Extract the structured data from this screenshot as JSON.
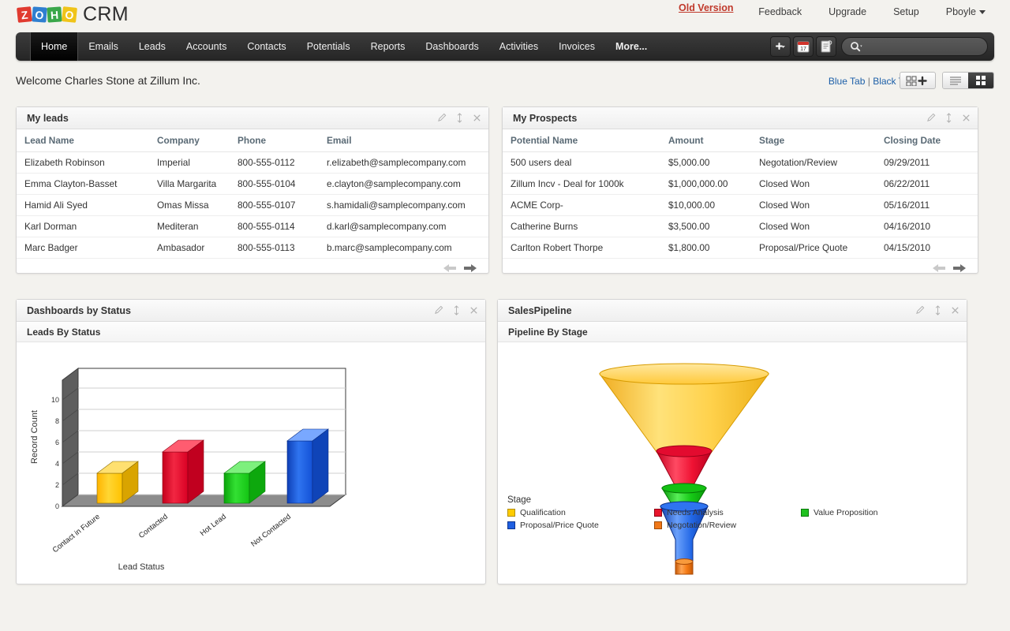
{
  "brand": {
    "tiles": [
      "Z",
      "O",
      "H",
      "O"
    ],
    "product": "CRM"
  },
  "header": {
    "old_version": "Old Version",
    "links": [
      "Feedback",
      "Upgrade",
      "Setup"
    ],
    "user": "Pboyle"
  },
  "nav": {
    "items": [
      "Home",
      "Emails",
      "Leads",
      "Accounts",
      "Contacts",
      "Potentials",
      "Reports",
      "Dashboards",
      "Activities",
      "Invoices",
      "More..."
    ],
    "active": "Home",
    "tools": [
      "add-icon",
      "calendar-icon",
      "notes-icon"
    ],
    "calendar_day": "17",
    "search_placeholder": ""
  },
  "welcome": {
    "text": "Welcome Charles Stone at Zillum Inc."
  },
  "tabs": {
    "blue": "Blue Tab",
    "separator": "|",
    "black": "Black Tab"
  },
  "view": {
    "add_label": "add-widget",
    "list_label": "list-view",
    "grid_label": "grid-view"
  },
  "panels": {
    "leads": {
      "title": "My leads",
      "columns": [
        "Lead Name",
        "Company",
        "Phone",
        "Email"
      ],
      "rows": [
        [
          "Elizabeth Robinson",
          "Imperial",
          "800-555-0112",
          "r.elizabeth@samplecompany.com"
        ],
        [
          "Emma Clayton-Basset",
          "Villa Margarita",
          "800-555-0104",
          "e.clayton@samplecompany.com"
        ],
        [
          "Hamid Ali Syed",
          "Omas Missa",
          "800-555-0107",
          "s.hamidali@samplecompany.com"
        ],
        [
          "Karl Dorman",
          "Mediteran",
          "800-555-0114",
          "d.karl@samplecompany.com"
        ],
        [
          "Marc Badger",
          "Ambasador",
          "800-555-0113",
          "b.marc@samplecompany.com"
        ]
      ]
    },
    "prospects": {
      "title": "My Prospects",
      "columns": [
        "Potential Name",
        "Amount",
        "Stage",
        "Closing Date"
      ],
      "rows": [
        [
          "500 users deal",
          "$5,000.00",
          "Negotation/Review",
          "09/29/2011"
        ],
        [
          "Zillum Incv - Deal for 1000k",
          "$1,000,000.00",
          "Closed Won",
          "06/22/2011"
        ],
        [
          "ACME Corp-",
          "$10,000.00",
          "Closed Won",
          "05/16/2011"
        ],
        [
          "Catherine Burns",
          "$3,500.00",
          "Closed Won",
          "04/16/2010"
        ],
        [
          "Carlton Robert Thorpe",
          "$1,800.00",
          "Proposal/Price Quote",
          "04/15/2010"
        ]
      ]
    },
    "dashboards_by_status": {
      "title": "Dashboards by Status",
      "sub_title": "Leads By Status"
    },
    "sales_pipeline": {
      "title": "SalesPipeline",
      "sub_title": "Pipeline By Stage"
    }
  },
  "chart_data": [
    {
      "type": "bar",
      "title": "Leads By Status",
      "categories": [
        "Contact in Future",
        "Contacted",
        "Hot Lead",
        "Not Contacted"
      ],
      "values": [
        3,
        5,
        3,
        7
      ],
      "colors": [
        "#ffcc00",
        "#e8152c",
        "#1fc11f",
        "#1f5fe0"
      ],
      "xlabel": "Lead Status",
      "ylabel": "Record Count",
      "ylim": [
        0,
        12
      ],
      "yticks": [
        "0",
        "2",
        "4",
        "6",
        "8",
        "10"
      ],
      "grid": true,
      "legend": "none"
    },
    {
      "type": "pie",
      "subtype": "funnel",
      "title": "Pipeline By Stage",
      "legend_title": "Stage",
      "categories": [
        "Qualification",
        "Needs Analysis",
        "Value Proposition",
        "Proposal/Price Quote",
        "Negotation/Review"
      ],
      "values": [
        100,
        46,
        28,
        24,
        8
      ],
      "colors": [
        "#ffcc00",
        "#e8152c",
        "#1fc11f",
        "#1f5fe0",
        "#f07818"
      ],
      "legend_position": "bottom"
    }
  ]
}
